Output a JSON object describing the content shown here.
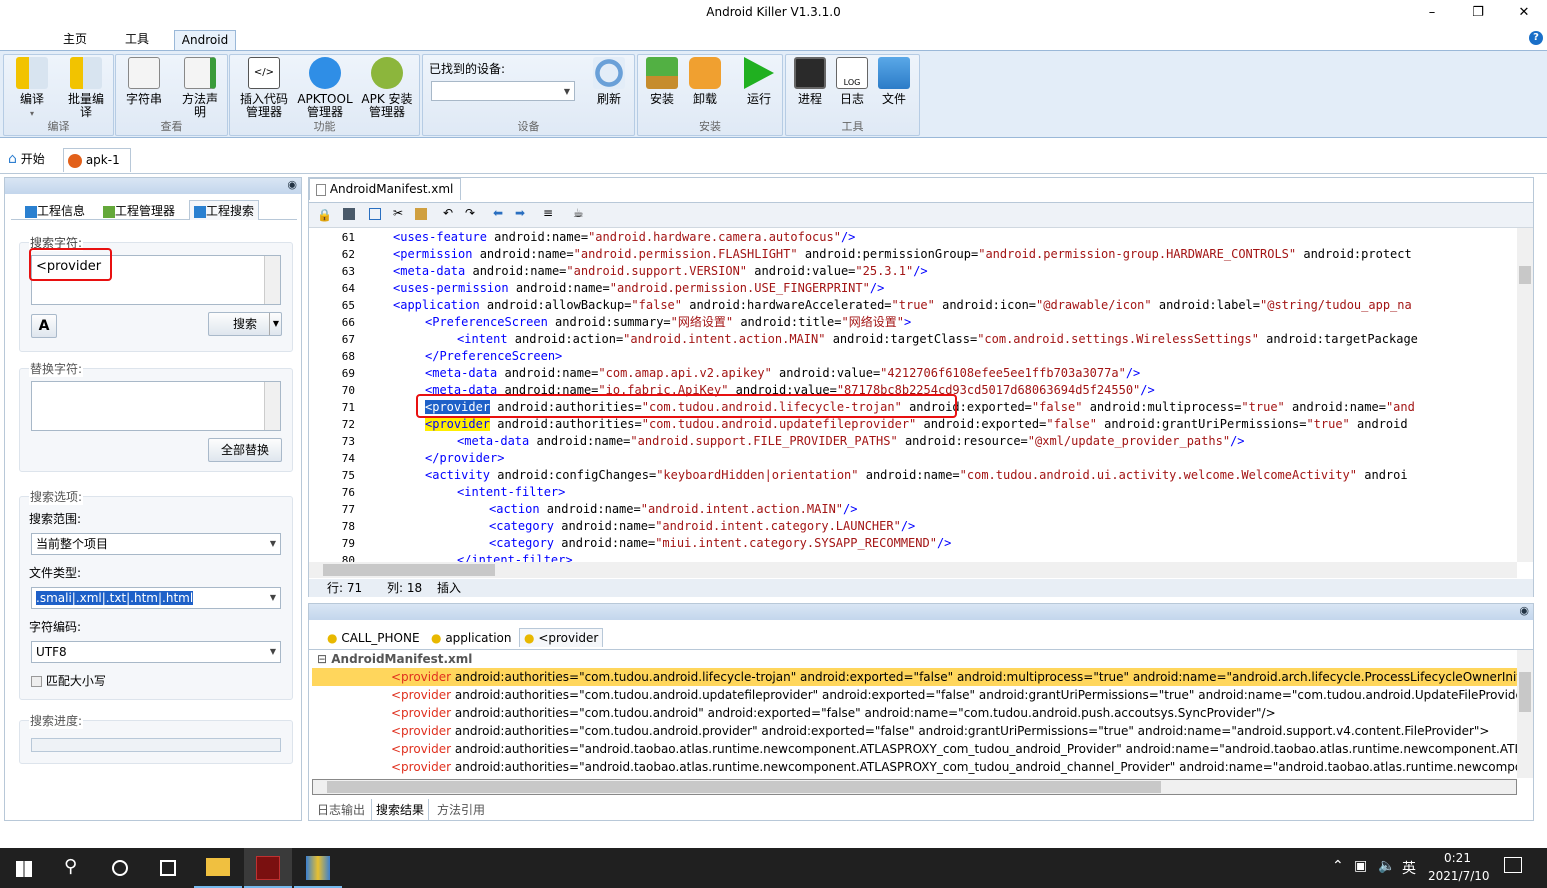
{
  "window": {
    "title": "Android Killer V1.3.1.0"
  },
  "ribbon": {
    "tabs": [
      "主页",
      "工具",
      "Android"
    ],
    "groups": {
      "compile": {
        "label": "编译",
        "buttons": [
          "编译",
          "批量编译"
        ]
      },
      "view": {
        "label": "查看",
        "buttons": [
          "字符串",
          "方法声明"
        ]
      },
      "function": {
        "label": "功能",
        "buttons": [
          "插入代码管理器",
          "APKTOOL管理器",
          "APK 安装管理器"
        ]
      },
      "device": {
        "label": "设备",
        "found_label": "已找到的设备:",
        "refresh": "刷新"
      },
      "install": {
        "label": "安装",
        "buttons": [
          "安装",
          "卸载",
          "运行"
        ]
      },
      "tools": {
        "label": "工具",
        "buttons": [
          "进程",
          "日志",
          "文件"
        ]
      }
    }
  },
  "doc_tabs": [
    "开始",
    "apk-1"
  ],
  "left": {
    "tabs": [
      "工程信息",
      "工程管理器",
      "工程搜索"
    ],
    "search_label": "搜索字符:",
    "search_value": "<provider",
    "search_button": "搜索",
    "replace_label": "替换字符:",
    "replace_value": "",
    "replace_all_button": "全部替换",
    "options_label": "搜索选项:",
    "scope_label": "搜索范围:",
    "scope_value": "当前整个项目",
    "filetype_label": "文件类型:",
    "filetype_value": ".smali|.xml|.txt|.htm|.html",
    "encoding_label": "字符编码:",
    "encoding_value": "UTF8",
    "matchcase_label": "匹配大小写",
    "progress_label": "搜索进度:"
  },
  "editor": {
    "tab": "AndroidManifest.xml",
    "status": {
      "row": "行: 71",
      "col": "列: 18",
      "mode": "插入"
    },
    "lines": [
      {
        "n": "61",
        "indent": 1,
        "html": "<span class='tag'>&lt;uses-feature</span> android:name=<span class='val'>\"android.hardware.camera.autofocus\"</span><span class='tag'>/&gt;</span>"
      },
      {
        "n": "62",
        "indent": 1,
        "html": "<span class='tag'>&lt;permission</span> android:name=<span class='val'>\"android.permission.FLASHLIGHT\"</span> android:permissionGroup=<span class='val'>\"android.permission-group.HARDWARE_CONTROLS\"</span> android:protect"
      },
      {
        "n": "63",
        "indent": 1,
        "html": "<span class='tag'>&lt;meta-data</span> android:name=<span class='val'>\"android.support.VERSION\"</span> android:value=<span class='val'>\"25.3.1\"</span><span class='tag'>/&gt;</span>"
      },
      {
        "n": "64",
        "indent": 1,
        "html": "<span class='tag'>&lt;uses-permission</span> android:name=<span class='val'>\"android.permission.USE_FINGERPRINT\"</span><span class='tag'>/&gt;</span>"
      },
      {
        "n": "65",
        "indent": 1,
        "html": "<span class='tag'>&lt;application</span> android:allowBackup=<span class='val'>\"false\"</span> android:hardwareAccelerated=<span class='val'>\"true\"</span> android:icon=<span class='val'>\"@drawable/icon\"</span> android:label=<span class='val'>\"@string/tudou_app_na</span>"
      },
      {
        "n": "66",
        "indent": 2,
        "html": "<span class='tag'>&lt;PreferenceScreen</span> android:summary=<span class='val'>\"网络设置\"</span> android:title=<span class='val'>\"网络设置\"</span><span class='tag'>&gt;</span>"
      },
      {
        "n": "67",
        "indent": 3,
        "html": "<span class='tag'>&lt;intent</span> android:action=<span class='val'>\"android.intent.action.MAIN\"</span> android:targetClass=<span class='val'>\"com.android.settings.WirelessSettings\"</span> android:targetPackage"
      },
      {
        "n": "68",
        "indent": 2,
        "html": "<span class='tag'>&lt;/PreferenceScreen&gt;</span>"
      },
      {
        "n": "69",
        "indent": 2,
        "html": "<span class='tag'>&lt;meta-data</span> android:name=<span class='val'>\"com.amap.api.v2.apikey\"</span> android:value=<span class='val'>\"4212706f6108efee5ee1ffb703a3077a\"</span><span class='tag'>/&gt;</span>"
      },
      {
        "n": "70",
        "indent": 2,
        "html": "<span class='tag'>&lt;meta-data</span> android:name=<span class='val'>\"io.fabric.ApiKey\"</span> android:value=<span class='val'>\"87178bc8b2254cd93cd5017d68063694d5f24550\"</span><span class='tag'>/&gt;</span>"
      },
      {
        "n": "71",
        "indent": 2,
        "html": "<span style='background:#1e60c8;color:#fff'>&lt;provider</span> android:authorities=<span class='val'>\"com.tudou.android.lifecycle-trojan\"</span> android:exported=<span class='val'>\"false\"</span> android:multiprocess=<span class='val'>\"true\"</span> android:name=<span class='val'>\"and</span>"
      },
      {
        "n": "72",
        "indent": 2,
        "html": "<span class='tag' style='background:#ffee00'>&lt;provider</span> android:authorities=<span class='val'>\"com.tudou.android.updatefileprovider\"</span> android:exported=<span class='val'>\"false\"</span> android:grantUriPermissions=<span class='val'>\"true\"</span> android"
      },
      {
        "n": "73",
        "indent": 3,
        "html": "<span class='tag'>&lt;meta-data</span> android:name=<span class='val'>\"android.support.FILE_PROVIDER_PATHS\"</span> android:resource=<span class='val'>\"@xml/update_provider_paths\"</span><span class='tag'>/&gt;</span>"
      },
      {
        "n": "74",
        "indent": 2,
        "html": "<span class='tag'>&lt;/provider&gt;</span>"
      },
      {
        "n": "75",
        "indent": 2,
        "html": "<span class='tag'>&lt;activity</span> android:configChanges=<span class='val'>\"keyboardHidden|orientation\"</span> android:name=<span class='val'>\"com.tudou.android.ui.activity.welcome.WelcomeActivity\"</span> androi"
      },
      {
        "n": "76",
        "indent": 3,
        "html": "<span class='tag'>&lt;intent-filter&gt;</span>"
      },
      {
        "n": "77",
        "indent": 4,
        "html": "<span class='tag'>&lt;action</span> android:name=<span class='val'>\"android.intent.action.MAIN\"</span><span class='tag'>/&gt;</span>"
      },
      {
        "n": "78",
        "indent": 4,
        "html": "<span class='tag'>&lt;category</span> android:name=<span class='val'>\"android.intent.category.LAUNCHER\"</span><span class='tag'>/&gt;</span>"
      },
      {
        "n": "79",
        "indent": 4,
        "html": "<span class='tag'>&lt;category</span> android:name=<span class='val'>\"miui.intent.category.SYSAPP_RECOMMEND\"</span><span class='tag'>/&gt;</span>"
      },
      {
        "n": "80",
        "indent": 3,
        "html": "<span class='tag'>&lt;/intent-filter&gt;</span>"
      }
    ]
  },
  "results": {
    "tabs": [
      "CALL_PHONE",
      "application",
      "<provider"
    ],
    "file": "AndroidManifest.xml",
    "rows": [
      {
        "tag": "<provider",
        "text": " android:authorities=\"com.tudou.android.lifecycle-trojan\" android:exported=\"false\" android:multiprocess=\"true\" android:name=\"android.arch.lifecycle.ProcessLifecycleOwnerInitializer\"/>"
      },
      {
        "tag": "<provider",
        "text": " android:authorities=\"com.tudou.android.updatefileprovider\" android:exported=\"false\" android:grantUriPermissions=\"true\" android:name=\"com.tudou.android.UpdateFileProvider\">"
      },
      {
        "tag": "<provider",
        "text": " android:authorities=\"com.tudou.android\" android:exported=\"false\" android:name=\"com.tudou.android.push.accoutsys.SyncProvider\"/>"
      },
      {
        "tag": "<provider",
        "text": " android:authorities=\"com.tudou.android.provider\" android:exported=\"false\" android:grantUriPermissions=\"true\" android:name=\"android.support.v4.content.FileProvider\">"
      },
      {
        "tag": "<provider",
        "text": " android:authorities=\"android.taobao.atlas.runtime.newcomponent.ATLASPROXY_com_tudou_android_Provider\" android:name=\"android.taobao.atlas.runtime.newcomponent.ATLASPRO"
      },
      {
        "tag": "<provider",
        "text": " android:authorities=\"android.taobao.atlas.runtime.newcomponent.ATLASPROXY_com_tudou_android_channel_Provider\" android:name=\"android.taobao.atlas.runtime.newcomponent.AT"
      }
    ],
    "bottom_tabs": [
      "日志输出",
      "搜索结果",
      "方法引用"
    ]
  },
  "taskbar": {
    "time": "0:21",
    "date": "2021/7/10",
    "ime": "英"
  }
}
